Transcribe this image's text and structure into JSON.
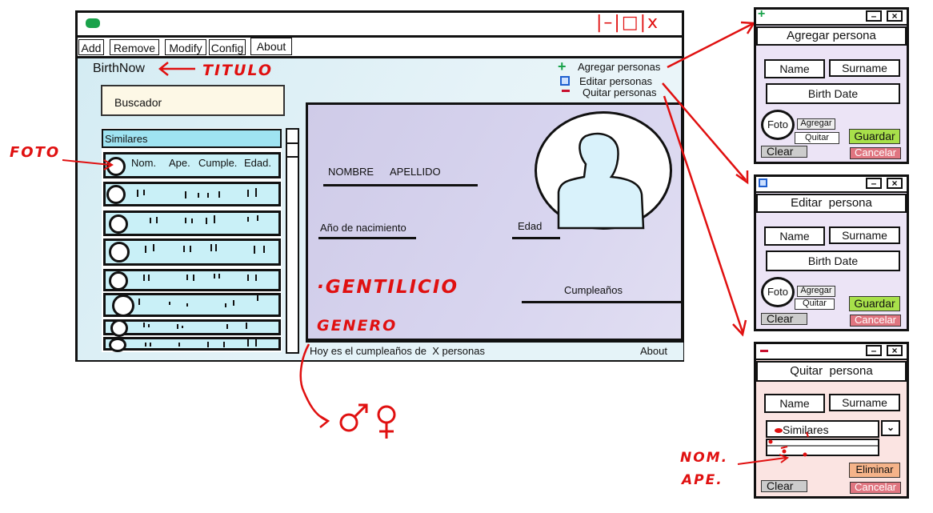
{
  "main_window": {
    "menu": [
      "Add",
      "Remove",
      "Modify",
      "Config",
      "About"
    ],
    "app_title": "BirthNow",
    "search_placeholder": "Buscador",
    "actions": {
      "add": "Agregar personas",
      "edit": "Editar personas",
      "remove": "Quitar personas"
    },
    "similars": {
      "header": "Similares",
      "columns": [
        "Nom.",
        "Ape.",
        "Cumple.",
        "Edad."
      ]
    },
    "detail": {
      "name_label": "NOMBRE",
      "surname_label": "APELLIDO",
      "birth_year_label": "Año de nacimiento",
      "age_label": "Edad",
      "birthday_label": "Cumpleaños"
    },
    "status_text": "Hoy es el cumpleaños de  X personas",
    "status_about": "About"
  },
  "annotations": {
    "title_note": "TITULO",
    "photo_note": "FOTO",
    "nationality_note": "·GENTILICIO",
    "gender_note": "GENERO",
    "gender_symbols": "♂♀",
    "window_controls": "|–|□|x",
    "nom_ape_note": [
      "NOM.",
      "APE."
    ]
  },
  "dialog_add": {
    "title": "Agregar persona",
    "name": "Name",
    "surname": "Surname",
    "birth_date": "Birth Date",
    "photo": "Foto",
    "photo_add": "Agregar",
    "photo_remove": "Quitar",
    "save": "Guardar",
    "clear": "Clear",
    "cancel": "Cancelar"
  },
  "dialog_edit": {
    "title": "Editar  persona",
    "name": "Name",
    "surname": "Surname",
    "birth_date": "Birth Date",
    "photo": "Foto",
    "photo_add": "Agregar",
    "photo_remove": "Quitar",
    "save": "Guardar",
    "clear": "Clear",
    "cancel": "Cancelar"
  },
  "dialog_remove": {
    "title": "Quitar  persona",
    "name": "Name",
    "surname": "Surname",
    "similars": "Similares",
    "delete": "Eliminar",
    "clear": "Clear",
    "cancel": "Cancelar"
  },
  "colors": {
    "annotation": "#e01010",
    "app_bg": "#e3f1f6",
    "detail_bg": "#d8d5ef",
    "list_row": "#c9f0f7",
    "save_green": "#a8e04a",
    "cancel_red": "#e07580",
    "delete_orange": "#f5b389"
  },
  "icons": [
    "app-logo-icon",
    "plus-icon",
    "edit-icon",
    "minus-icon",
    "male-symbol-icon",
    "female-symbol-icon"
  ]
}
